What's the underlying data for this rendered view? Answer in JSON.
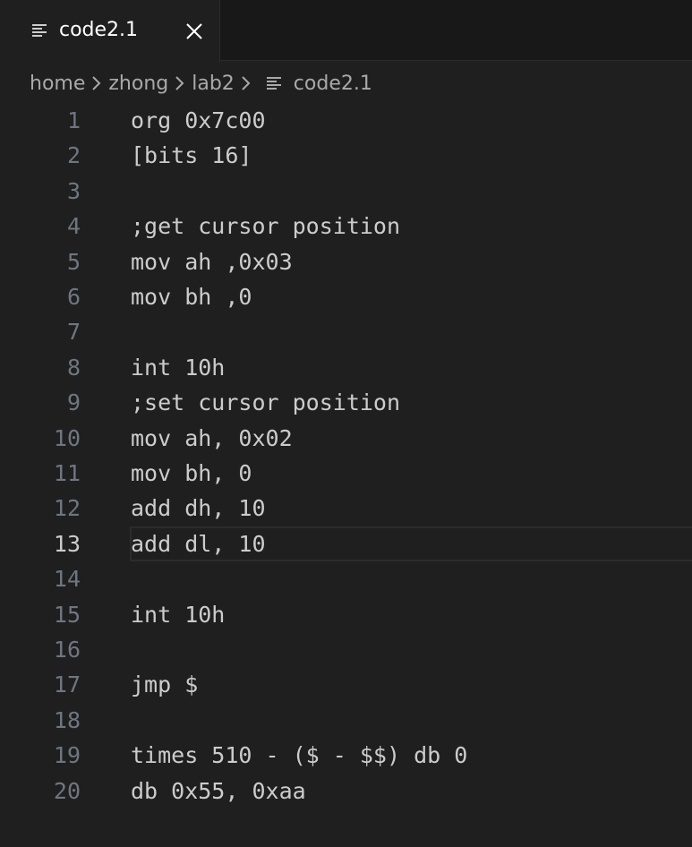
{
  "tab": {
    "label": "code2.1",
    "icon": "file-lines-icon",
    "close_icon": "close-icon"
  },
  "breadcrumb": {
    "items": [
      "home",
      "zhong",
      "lab2",
      "code2.1"
    ],
    "separator_icon": "chevron-right-icon"
  },
  "editor": {
    "active_line": 13,
    "lines": [
      {
        "num": "1",
        "text": "org 0x7c00"
      },
      {
        "num": "2",
        "text": "[bits 16]"
      },
      {
        "num": "3",
        "text": ""
      },
      {
        "num": "4",
        "text": ";get cursor position"
      },
      {
        "num": "5",
        "text": "mov ah ,0x03"
      },
      {
        "num": "6",
        "text": "mov bh ,0"
      },
      {
        "num": "7",
        "text": ""
      },
      {
        "num": "8",
        "text": "int 10h"
      },
      {
        "num": "9",
        "text": ";set cursor position"
      },
      {
        "num": "10",
        "text": "mov ah, 0x02"
      },
      {
        "num": "11",
        "text": "mov bh, 0"
      },
      {
        "num": "12",
        "text": "add dh, 10"
      },
      {
        "num": "13",
        "text": "add dl, 10"
      },
      {
        "num": "14",
        "text": ""
      },
      {
        "num": "15",
        "text": "int 10h"
      },
      {
        "num": "16",
        "text": ""
      },
      {
        "num": "17",
        "text": "jmp $"
      },
      {
        "num": "18",
        "text": ""
      },
      {
        "num": "19",
        "text": "times 510 - ($ - $$) db 0"
      },
      {
        "num": "20",
        "text": "db 0x55, 0xaa"
      }
    ]
  },
  "colors": {
    "background": "#1f1f1f",
    "tabbar": "#181818",
    "text": "#cccccc",
    "line_number": "#6e7681",
    "breadcrumb": "#a9a9a9"
  }
}
